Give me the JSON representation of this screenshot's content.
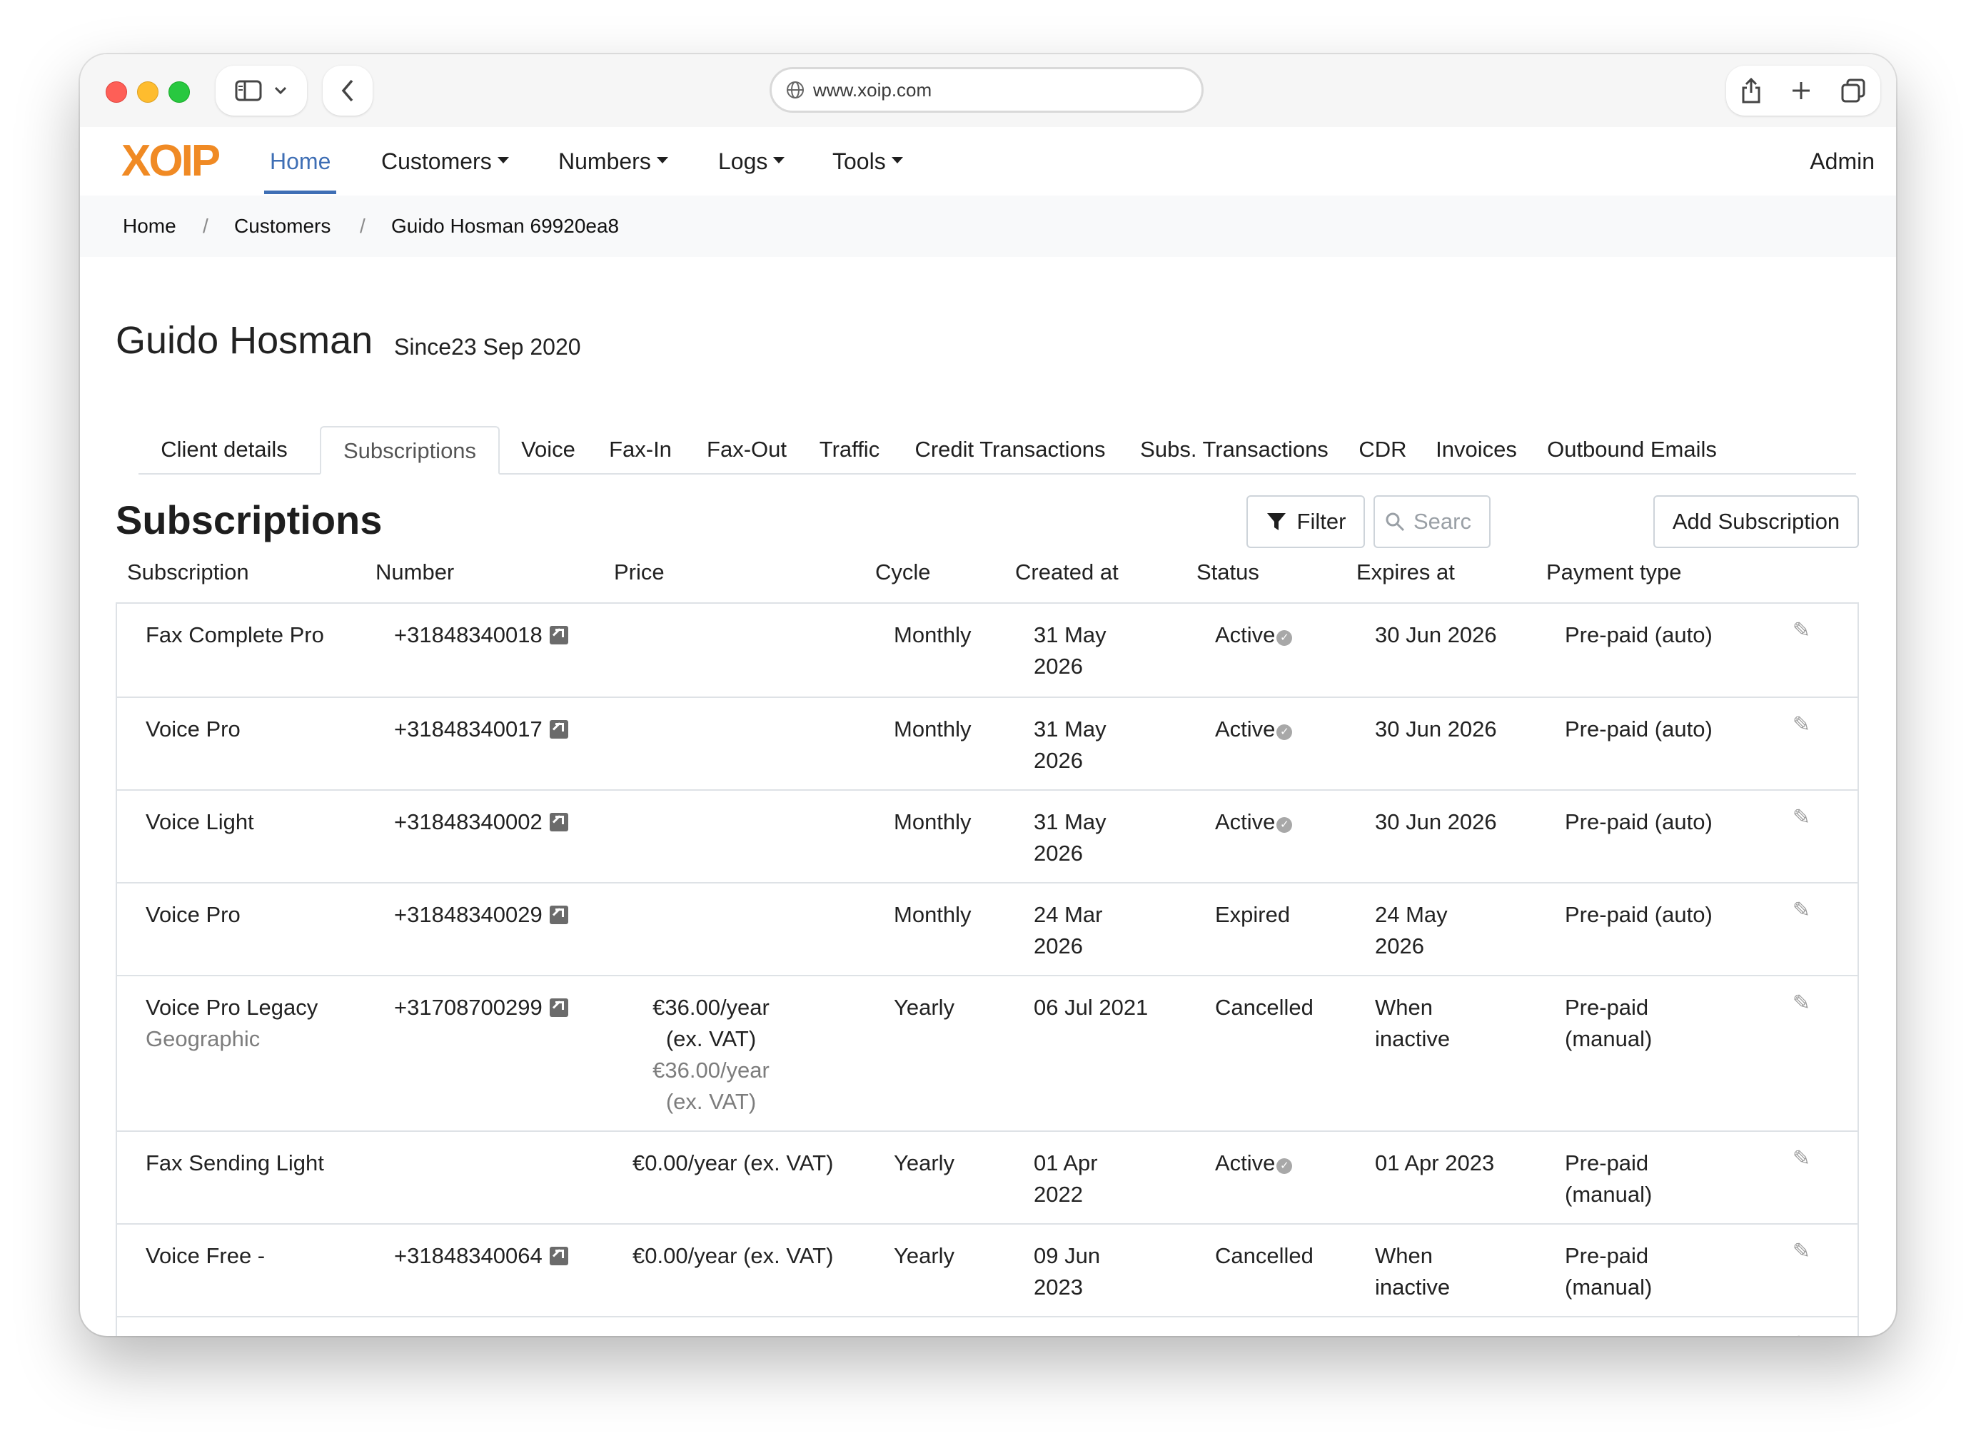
{
  "browser": {
    "url": "www.xoip.com"
  },
  "nav": {
    "logo": "XOIP",
    "items": [
      {
        "label": "Home"
      },
      {
        "label": "Customers"
      },
      {
        "label": "Numbers"
      },
      {
        "label": "Logs"
      },
      {
        "label": "Tools"
      }
    ],
    "user": "Admin"
  },
  "breadcrumb": [
    "Home",
    "Customers",
    "Guido Hosman 69920ea8"
  ],
  "customer": {
    "name": "Guido Hosman",
    "since": "Since23 Sep 2020"
  },
  "tabs": [
    "Client details",
    "Subscriptions",
    "Voice",
    "Fax-In",
    "Fax-Out",
    "Traffic",
    "Credit Transactions",
    "Subs. Transactions",
    "CDR",
    "Invoices",
    "Outbound Emails"
  ],
  "section": {
    "title": "Subscriptions",
    "filter_label": "Filter",
    "search_placeholder": "Searc",
    "add_label": "Add Subscription"
  },
  "table": {
    "headers": [
      "Subscription",
      "Number",
      "Price",
      "Cycle",
      "Created at",
      "Status",
      "Expires at",
      "Payment type"
    ],
    "rows": [
      {
        "subscription": "Fax Complete Pro",
        "subtitle": "",
        "number": "+31848340018",
        "price": "",
        "price_sub": "",
        "cycle": "Monthly",
        "created_1": "31 May",
        "created_2": "2026",
        "status": "Active",
        "status_check": true,
        "expires_1": "30 Jun 2026",
        "expires_2": "",
        "payment_1": "Pre-paid (auto)",
        "payment_2": ""
      },
      {
        "subscription": "Voice Pro",
        "subtitle": "",
        "number": "+31848340017",
        "price": "",
        "price_sub": "",
        "cycle": "Monthly",
        "created_1": "31 May",
        "created_2": "2026",
        "status": "Active",
        "status_check": true,
        "expires_1": "30 Jun 2026",
        "expires_2": "",
        "payment_1": "Pre-paid (auto)",
        "payment_2": ""
      },
      {
        "subscription": "Voice Light",
        "subtitle": "",
        "number": "+31848340002",
        "price": "",
        "price_sub": "",
        "cycle": "Monthly",
        "created_1": "31 May",
        "created_2": "2026",
        "status": "Active",
        "status_check": true,
        "expires_1": "30 Jun 2026",
        "expires_2": "",
        "payment_1": "Pre-paid (auto)",
        "payment_2": ""
      },
      {
        "subscription": "Voice Pro",
        "subtitle": "",
        "number": "+31848340029",
        "price": "",
        "price_sub": "",
        "cycle": "Monthly",
        "created_1": "24 Mar",
        "created_2": "2026",
        "status": "Expired",
        "status_check": false,
        "expires_1": "24 May",
        "expires_2": "2026",
        "payment_1": "Pre-paid (auto)",
        "payment_2": ""
      },
      {
        "subscription": "Voice Pro Legacy",
        "subtitle": "Geographic",
        "number": "+31708700299",
        "price": "€36.00/year (ex. VAT)",
        "price_sub": "€36.00/year (ex. VAT)",
        "cycle": "Yearly",
        "created_1": "06 Jul 2021",
        "created_2": "",
        "status": "Cancelled",
        "status_check": false,
        "expires_1": "When",
        "expires_2": "inactive",
        "payment_1": "Pre-paid",
        "payment_2": "(manual)"
      },
      {
        "subscription": "Fax Sending Light",
        "subtitle": "",
        "number": "",
        "price": "€0.00/year (ex. VAT)",
        "price_sub": "",
        "cycle": "Yearly",
        "created_1": "01 Apr",
        "created_2": "2022",
        "status": "Active",
        "status_check": true,
        "expires_1": "01 Apr 2023",
        "expires_2": "",
        "payment_1": "Pre-paid",
        "payment_2": "(manual)"
      },
      {
        "subscription": "Voice Free -",
        "subtitle": "",
        "number": "+31848340064",
        "price": "€0.00/year (ex. VAT)",
        "price_sub": "",
        "cycle": "Yearly",
        "created_1": "09 Jun",
        "created_2": "2023",
        "status": "Cancelled",
        "status_check": false,
        "expires_1": "When",
        "expires_2": "inactive",
        "payment_1": "Pre-paid",
        "payment_2": "(manual)"
      }
    ]
  },
  "colors": {
    "logo": "#f08a24",
    "nav_active": "#3f6fb5",
    "border": "#dee2e6",
    "muted_text": "#7d7d7d"
  }
}
